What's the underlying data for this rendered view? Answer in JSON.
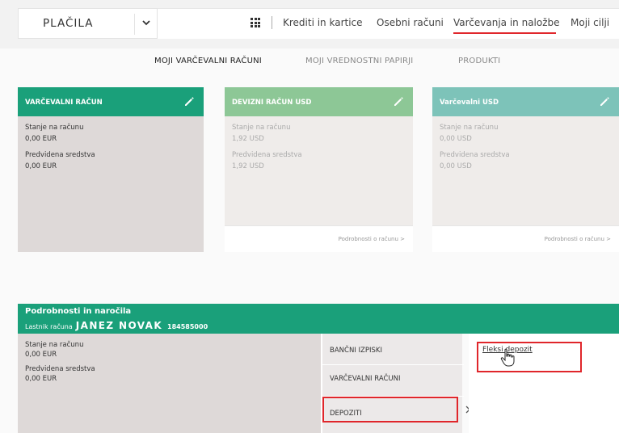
{
  "topbar": {
    "section_label": "PLAČILA",
    "nav": [
      {
        "label": "Krediti in kartice"
      },
      {
        "label": "Osebni računi"
      },
      {
        "label": "Varčevanja in naložbe",
        "active": true
      },
      {
        "label": "Moji cilji"
      }
    ]
  },
  "tabs": [
    {
      "label": "MOJI VARČEVALNI RAČUNI",
      "active": true
    },
    {
      "label": "MOJI VREDNOSTNI PAPIRJI",
      "active": false
    },
    {
      "label": "PRODUKTI",
      "active": false
    }
  ],
  "cards": [
    {
      "title": "VARČEVALNI RAČUN",
      "balance_label": "Stanje na računu",
      "balance_value": "0,00 EUR",
      "planned_label": "Predvidena sredstva",
      "planned_value": "0,00 EUR",
      "footer": "",
      "header_color": "#1aa07a",
      "body_color": "#ded9d8"
    },
    {
      "title": "DEVIZNI RAČUN USD",
      "balance_label": "Stanje na računu",
      "balance_value": "1,92 USD",
      "planned_label": "Predvidena sredstva",
      "planned_value": "1,92 USD",
      "footer": "Podrobnosti o računu  >",
      "header_color": "#8dc796",
      "body_color": "#efecea"
    },
    {
      "title": "Varčevalni USD",
      "balance_label": "Stanje na računu",
      "balance_value": "0,00 USD",
      "planned_label": "Predvidena sredstva",
      "planned_value": "0,00 USD",
      "footer": "Podrobnosti o računu  >",
      "header_color": "#7dc3b9",
      "body_color": "#efecea"
    }
  ],
  "details": {
    "title": "Podrobnosti in naročila",
    "owner_label": "Lastnik računa",
    "owner_name": "JANEZ NOVAK",
    "account_number": "184585000",
    "balance_label": "Stanje na računu",
    "balance_value": "0,00 EUR",
    "planned_label": "Predvidena sredstva",
    "planned_value": "0,00 EUR",
    "menu": [
      {
        "label": "BANČNI IZPISKI"
      },
      {
        "label": "VARČEVALNI RAČUNI"
      },
      {
        "label": "DEPOZITI",
        "active": true
      }
    ],
    "submenu_link": "Fleksi depozit"
  },
  "colors": {
    "accent_red": "#e0262b",
    "brand_green": "#1aa07a"
  }
}
